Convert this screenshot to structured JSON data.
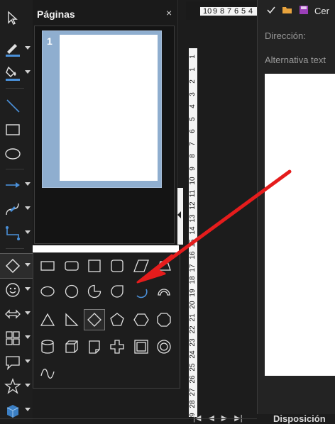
{
  "pages_panel": {
    "title": "Páginas",
    "close": "×",
    "thumbnail_number": "1"
  },
  "ruler_h": {
    "labels": [
      "10",
      "9",
      "8",
      "7",
      "6",
      "5",
      "4"
    ]
  },
  "ruler_v": {
    "labels": [
      "1",
      "1",
      "2",
      "3",
      "4",
      "5",
      "6",
      "7",
      "8",
      "9",
      "10",
      "11",
      "12",
      "13",
      "14",
      "15",
      "16",
      "17",
      "18",
      "19",
      "20",
      "21",
      "22",
      "23",
      "24",
      "25",
      "26",
      "27",
      "28",
      "29"
    ]
  },
  "properties": {
    "top_button": "Cer",
    "direction_label": "Dirección:",
    "alt_text_label": "Alternativa text"
  },
  "bottom_tab": "Disposición",
  "colors": {
    "accent": "#4a90d9",
    "arrow_red": "#e51c1c",
    "highlight_blue": "#8faecf"
  },
  "toolbar_icons": [
    "select-icon",
    "line-color-icon",
    "fill-color-icon",
    "line-icon",
    "rectangle-icon",
    "ellipse-icon",
    "arrow-line-icon",
    "curve-icon",
    "connector-icon",
    "basic-shapes-icon",
    "symbol-shapes-icon",
    "block-arrows-icon",
    "flowchart-icon",
    "callout-icon",
    "stars-icon",
    "3d-objects-icon"
  ],
  "shape_icons": [
    "rectangle",
    "rounded-rectangle",
    "square",
    "rounded-square",
    "parallelogram",
    "trapezoid",
    "ellipse",
    "circle",
    "circle-pie",
    "teardrop",
    "block-arc",
    "arc",
    "isosceles-triangle",
    "right-triangle",
    "diamond",
    "pentagon",
    "hexagon",
    "octagon",
    "cylinder",
    "cube",
    "folded-corner",
    "cross",
    "frame",
    "ring",
    "wave"
  ]
}
